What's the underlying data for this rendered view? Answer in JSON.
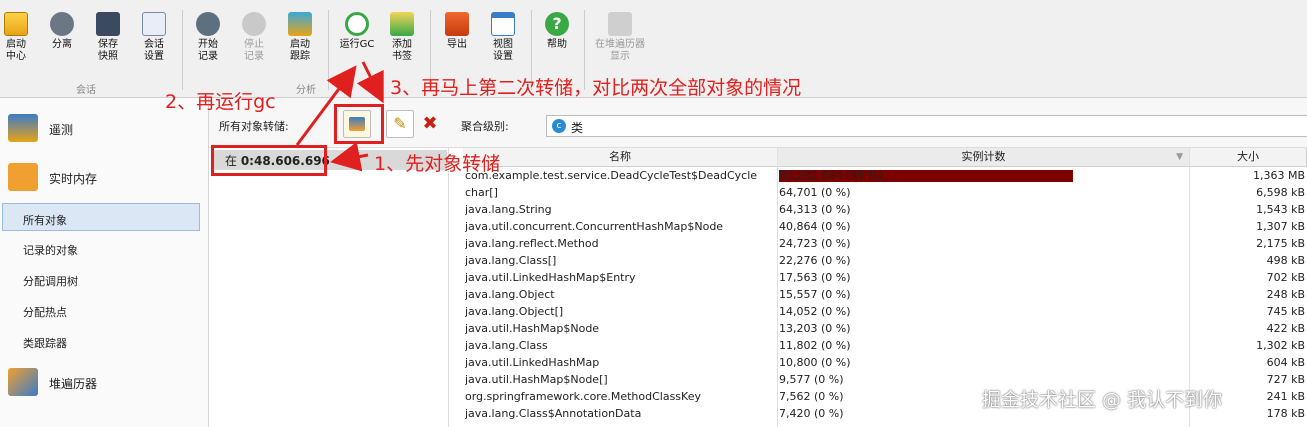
{
  "toolbar": {
    "buttons": [
      {
        "label": "启动\n中心",
        "icon": "startup-center-icon"
      },
      {
        "label": "分离",
        "icon": "detach-icon"
      },
      {
        "label": "保存\n快照",
        "icon": "save-snapshot-icon"
      },
      {
        "label": "会话\n设置",
        "icon": "session-settings-icon"
      },
      {
        "label": "开始\n记录",
        "icon": "start-recording-icon"
      },
      {
        "label": "停止\n记录",
        "icon": "stop-recording-icon"
      },
      {
        "label": "启动\n跟踪",
        "icon": "start-tracking-icon"
      },
      {
        "label": "运行GC",
        "icon": "run-gc-icon"
      },
      {
        "label": "添加\n书签",
        "icon": "add-bookmark-icon"
      },
      {
        "label": "导出",
        "icon": "export-icon"
      },
      {
        "label": "视图\n设置",
        "icon": "view-settings-icon"
      },
      {
        "label": "帮助",
        "icon": "help-icon"
      },
      {
        "label": "在堆遍历器\n显示",
        "icon": "show-in-heap-walker-icon"
      }
    ],
    "groups": [
      "会话",
      "分析"
    ]
  },
  "sidebar": {
    "sections": [
      {
        "label": "遥测",
        "icon": "telemetry-icon"
      },
      {
        "label": "实时内存",
        "icon": "live-memory-icon"
      },
      {
        "label": "堆遍历器",
        "icon": "heap-walker-icon"
      }
    ],
    "items": [
      "所有对象",
      "记录的对象",
      "分配调用树",
      "分配热点",
      "类跟踪器"
    ]
  },
  "snapshot_bar": {
    "label": "所有对象转储:",
    "agg_label": "聚合级别:",
    "agg_value": "类",
    "snapshot_prefix": "在 ",
    "snapshot_time": "0:48.606.696"
  },
  "table": {
    "headers": [
      "名称",
      "实例计数",
      "大小"
    ],
    "rows": [
      {
        "name": "com.example.test.service.DeadCycleTest$DeadCycle",
        "count": "85,202,584 (99 %)",
        "size": "1,363 MB",
        "frac": 0.99
      },
      {
        "name": "char[]",
        "count": "64,701 (0 %)",
        "size": "6,598 kB"
      },
      {
        "name": "java.lang.String",
        "count": "64,313 (0 %)",
        "size": "1,543 kB"
      },
      {
        "name": "java.util.concurrent.ConcurrentHashMap$Node",
        "count": "40,864 (0 %)",
        "size": "1,307 kB"
      },
      {
        "name": "java.lang.reflect.Method",
        "count": "24,723 (0 %)",
        "size": "2,175 kB"
      },
      {
        "name": "java.lang.Class[]",
        "count": "22,276 (0 %)",
        "size": "498 kB"
      },
      {
        "name": "java.util.LinkedHashMap$Entry",
        "count": "17,563 (0 %)",
        "size": "702 kB"
      },
      {
        "name": "java.lang.Object",
        "count": "15,557 (0 %)",
        "size": "248 kB"
      },
      {
        "name": "java.lang.Object[]",
        "count": "14,052 (0 %)",
        "size": "745 kB"
      },
      {
        "name": "java.util.HashMap$Node",
        "count": "13,203 (0 %)",
        "size": "422 kB"
      },
      {
        "name": "java.lang.Class",
        "count": "11,802 (0 %)",
        "size": "1,302 kB"
      },
      {
        "name": "java.util.LinkedHashMap",
        "count": "10,800 (0 %)",
        "size": "604 kB"
      },
      {
        "name": "java.util.HashMap$Node[]",
        "count": "9,577 (0 %)",
        "size": "727 kB"
      },
      {
        "name": "org.springframework.core.MethodClassKey",
        "count": "7,562 (0 %)",
        "size": "241 kB"
      },
      {
        "name": "java.lang.Class$AnnotationData",
        "count": "7,420 (0 %)",
        "size": "178 kB"
      }
    ]
  },
  "annotations": {
    "a1": "1、先对象转储",
    "a2": "2、再运行gc",
    "a3": "3、再马上第二次转储，对比两次全部对象的情况"
  },
  "watermark": "掘金技术社区 @ 我认不到你",
  "colors": {
    "annotation": "#e0201e",
    "bar": "#7d0000",
    "selection": "#dbe7f5"
  }
}
